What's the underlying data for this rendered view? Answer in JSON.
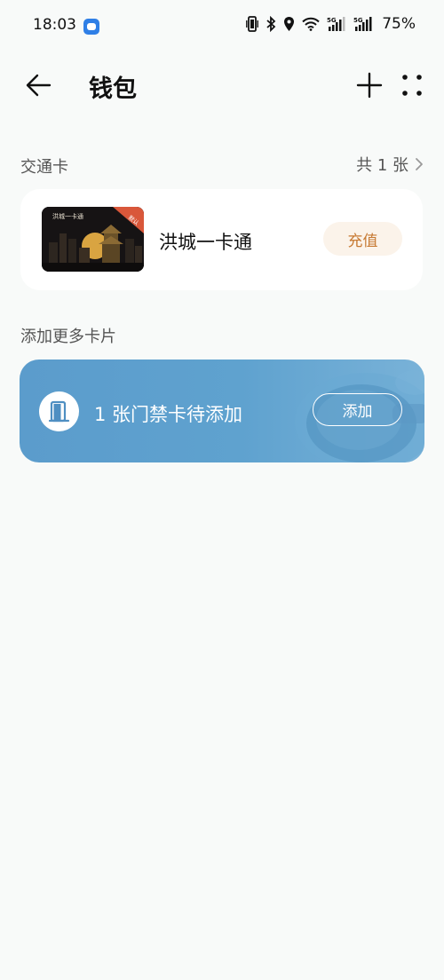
{
  "status_bar": {
    "time": "18:03",
    "battery": "75%",
    "icons": [
      "vibrate-icon",
      "bluetooth-icon",
      "location-icon",
      "wifi-icon",
      "5g-signal-icon",
      "5g-signal-icon"
    ]
  },
  "header": {
    "title": "钱包",
    "icons": [
      "back-arrow-icon",
      "plus-icon",
      "more-dots-icon"
    ]
  },
  "transit": {
    "section_label": "交通卡",
    "count_label": "共 1 张",
    "card": {
      "name": "洪城一卡通",
      "thumb_title": "洪城一卡通",
      "badge": "默认",
      "action_label": "充值"
    }
  },
  "add_more": {
    "section_label": "添加更多卡片",
    "banner_text": "1 张门禁卡待添加",
    "action_label": "添加",
    "icon": "door-icon"
  },
  "colors": {
    "background": "#f8faf9",
    "card_panel": "#ffffff",
    "recharge_bg": "#fbf3ea",
    "recharge_text": "#c77a33",
    "banner_blue": "#5fa2cf"
  }
}
